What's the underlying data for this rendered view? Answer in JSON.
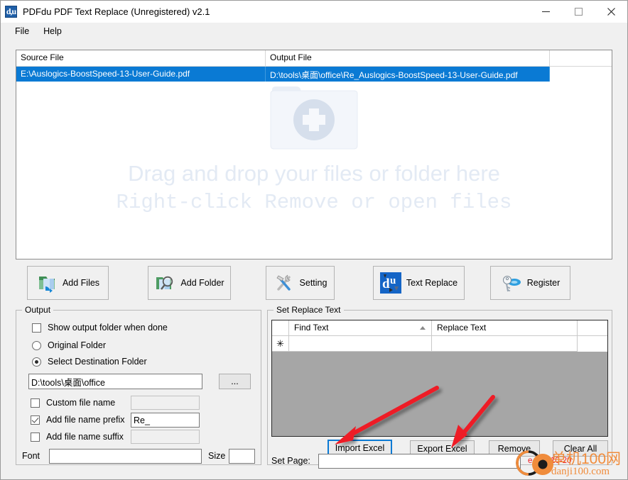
{
  "window": {
    "title": "PDFdu PDF Text Replace (Unregistered) v2.1",
    "app_icon": "d,u",
    "minimize": "minimize-icon",
    "maximize": "maximize-icon",
    "close": "close-icon"
  },
  "menu": {
    "items": [
      {
        "label": "File"
      },
      {
        "label": "Help"
      }
    ]
  },
  "file_list": {
    "columns": [
      "Source File",
      "Output File",
      ""
    ],
    "rows": [
      {
        "source": "E:\\Auslogics-BoostSpeed-13-User-Guide.pdf",
        "output": "D:\\tools\\桌面\\office\\Re_Auslogics-BoostSpeed-13-User-Guide.pdf",
        "selected": true
      }
    ],
    "placeholder": {
      "line1": "Drag and drop your files or folder here",
      "line2": "Right-click Remove or open files",
      "icon": "add-folder-placeholder-icon"
    }
  },
  "toolbar": {
    "buttons": [
      {
        "label": "Add Files",
        "icon": "add-files-icon"
      },
      {
        "label": "Add Folder",
        "icon": "add-folder-icon"
      },
      {
        "label": "Setting",
        "icon": "setting-tools-icon"
      },
      {
        "label": "Text Replace",
        "icon": "text-replace-app-icon"
      },
      {
        "label": "Register",
        "icon": "register-key-icon"
      }
    ]
  },
  "output": {
    "title": "Output",
    "show_output_folder": {
      "label": "Show output folder when done",
      "checked": false
    },
    "original_folder": {
      "label": "Original Folder",
      "selected": false
    },
    "select_destination_folder": {
      "label": "Select Destination Folder",
      "selected": true
    },
    "destination_path": {
      "value": "D:\\tools\\桌面\\office"
    },
    "browse_button": {
      "label": "..."
    },
    "custom_file_name": {
      "label": "Custom file name",
      "checked": false,
      "value": ""
    },
    "add_file_name_prefix": {
      "label": "Add file name prefix",
      "checked": true,
      "value": "Re_"
    },
    "add_file_name_suffix": {
      "label": "Add file name suffix",
      "checked": false,
      "value": ""
    },
    "font": {
      "label": "Font",
      "value": ""
    },
    "size": {
      "label": "Size",
      "value": ""
    }
  },
  "replace": {
    "title": "Set Replace Text",
    "grid": {
      "columns": [
        "",
        "Find Text",
        "Replace Text"
      ],
      "sort_indicator": "sort-ascending-icon",
      "new_row_marker": "✳",
      "rows": [
        {
          "find": "",
          "replace": ""
        }
      ]
    },
    "buttons": [
      {
        "label": "Import Excel",
        "focused": true
      },
      {
        "label": "Export Excel",
        "focused": false
      },
      {
        "label": "Remove",
        "focused": false
      },
      {
        "label": "Clear All",
        "focused": false
      }
    ],
    "set_page": {
      "label": "Set Page:",
      "value": "",
      "hint": "e.g.:8,10-20"
    }
  },
  "annotations": {
    "arrows": [
      {
        "target": "Import Excel",
        "color": "#ee1c25"
      },
      {
        "target": "Export Excel",
        "color": "#ee1c25"
      }
    ]
  },
  "watermark": {
    "text_cn": "单机100网",
    "text_en": "danji100.com",
    "color": "#f08c3c",
    "logo": "danji100-logo-icon"
  },
  "colors": {
    "accent_selection": "#0a7ad4",
    "window_background": "#f0f0f0",
    "grid_background": "#a6a6a6",
    "placeholder_text": "#e3eaf4",
    "annotation_red": "#ee1c25",
    "watermark_orange": "#f08c3c"
  }
}
